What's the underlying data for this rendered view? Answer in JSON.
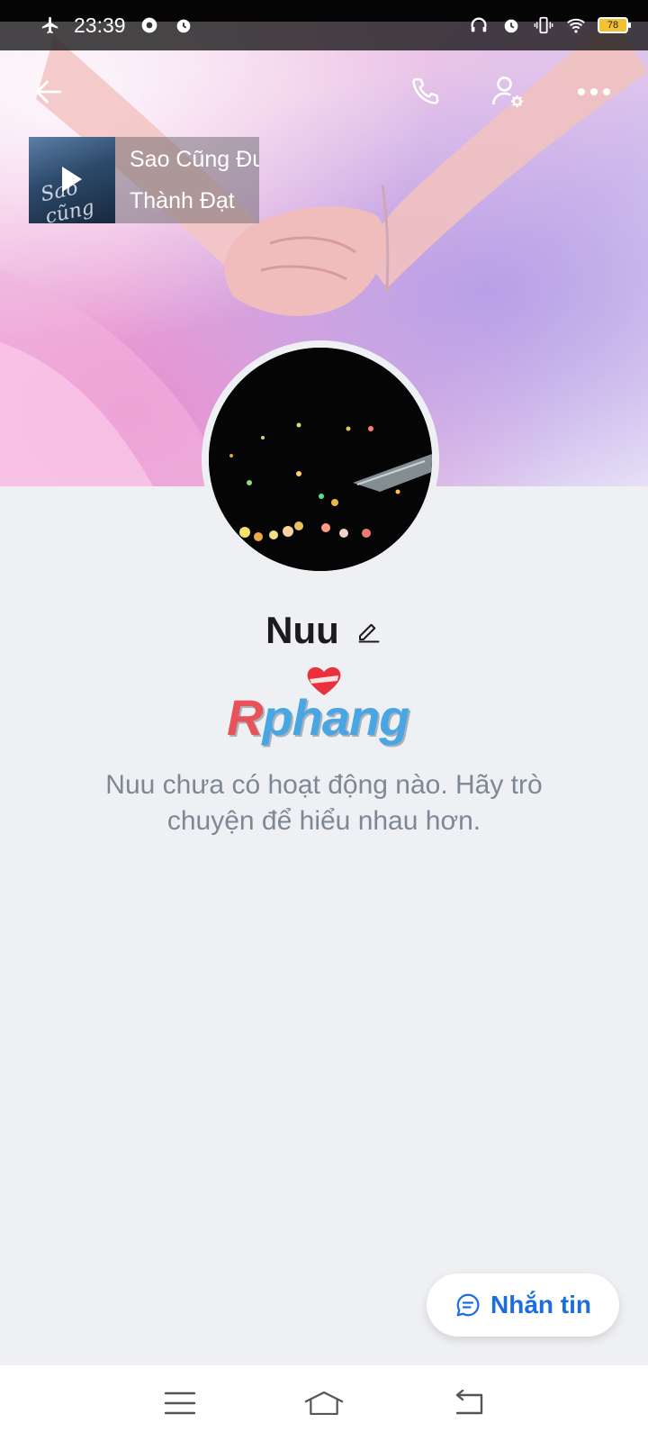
{
  "status_bar": {
    "time": "23:39",
    "battery": "78",
    "icons": [
      "airplane-icon",
      "chrome-icon",
      "alarm-icon",
      "headphones-icon",
      "alarm-icon",
      "vibrate-icon",
      "wifi-icon",
      "battery-icon"
    ]
  },
  "header": {
    "actions": [
      "back-arrow-icon",
      "phone-icon",
      "profile-settings-icon",
      "more-icon"
    ]
  },
  "music": {
    "title": "Sao Cũng Đư",
    "artist": "Thành Đạt",
    "thumb_text": "Sao cũng được"
  },
  "profile": {
    "name": "Nuu",
    "sticker_text": "Rphang",
    "empty_message": "Nuu chưa có hoạt động nào. Hãy trò chuyện để hiểu nhau hơn."
  },
  "message_button": {
    "label": "Nhắn tin"
  },
  "colors": {
    "accent": "#1c6ee0",
    "background": "#eff0f4",
    "muted_text": "#7e8894"
  },
  "nav": {
    "buttons": [
      "menu-icon",
      "home-icon",
      "back-icon"
    ]
  }
}
